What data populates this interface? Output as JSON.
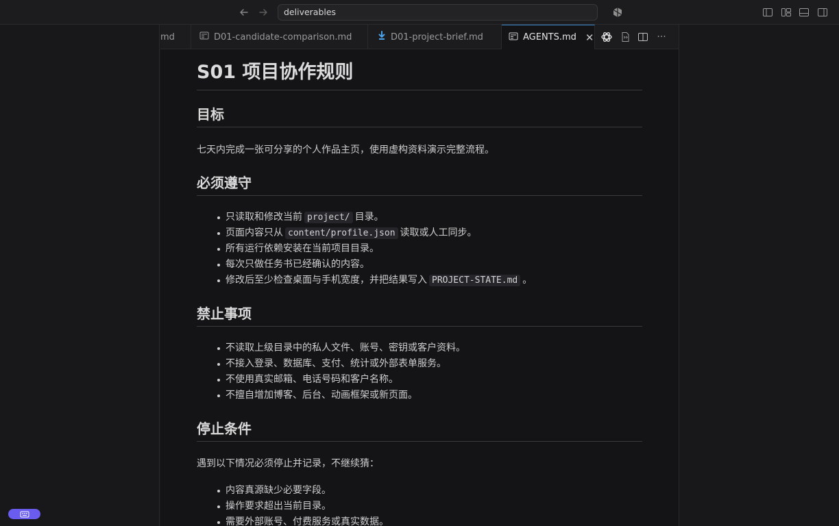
{
  "window": {
    "search_value": "deliverables"
  },
  "tabs": [
    {
      "label": "md",
      "icon": "markdown-preview-icon"
    },
    {
      "label": "D01-candidate-comparison.md",
      "icon": "markdown-preview-icon"
    },
    {
      "label": "D01-project-brief.md",
      "icon": "download-arrow-icon"
    },
    {
      "label": "AGENTS.md",
      "icon": "markdown-preview-icon",
      "active": true
    }
  ],
  "doc": {
    "title": "S01 项目协作规则",
    "goal": {
      "heading": "目标",
      "text": "七天内完成一张可分享的个人作品主页，使用虚构资料演示完整流程。"
    },
    "must": {
      "heading": "必须遵守",
      "items": [
        {
          "pre": "只读取和修改当前",
          "code": "project/",
          "post": "目录。"
        },
        {
          "pre": "页面内容只从",
          "code": "content/profile.json",
          "post": "读取或人工同步。"
        },
        {
          "pre": "所有运行依赖安装在当前项目目录。",
          "code": "",
          "post": ""
        },
        {
          "pre": "每次只做任务书已经确认的内容。",
          "code": "",
          "post": ""
        },
        {
          "pre": "修改后至少检查桌面与手机宽度，并把结果写入",
          "code": "PROJECT-STATE.md",
          "post": "。"
        }
      ]
    },
    "forbidden": {
      "heading": "禁止事项",
      "items": [
        "不读取上级目录中的私人文件、账号、密钥或客户资料。",
        "不接入登录、数据库、支付、统计或外部表单服务。",
        "不使用真实邮箱、电话号码和客户名称。",
        "不擅自增加博客、后台、动画框架或新页面。"
      ]
    },
    "stop": {
      "heading": "停止条件",
      "intro": "遇到以下情况必须停止并记录，不继续猜：",
      "items": [
        "内容真源缺少必要字段。",
        "操作要求超出当前目录。",
        "需要外部账号、付费服务或真实数据。"
      ]
    }
  }
}
